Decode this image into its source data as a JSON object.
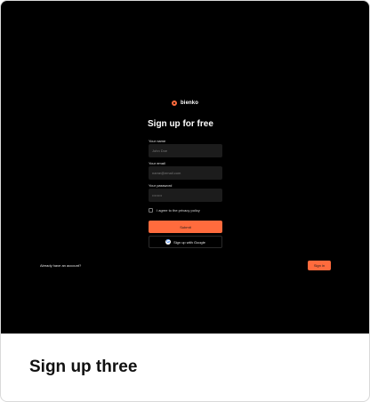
{
  "brand": {
    "name": "bienko",
    "logo_icon": "circle-logo-icon",
    "accent_color": "#ff6b3d"
  },
  "form": {
    "title": "Sign up for free",
    "name_label": "Your name",
    "name_placeholder": "John Doe",
    "email_label": "Your email",
    "email_placeholder": "name@email.com",
    "password_label": "Your password",
    "password_placeholder": "••••••••",
    "agree_label": "I agree to the privacy policy",
    "submit_label": "Submit",
    "google_label": "Sign up with Google",
    "google_icon": "google-icon"
  },
  "footer": {
    "have_account_text": "Already have an account?",
    "signin_label": "Sign in"
  },
  "card": {
    "caption": "Sign up three"
  }
}
